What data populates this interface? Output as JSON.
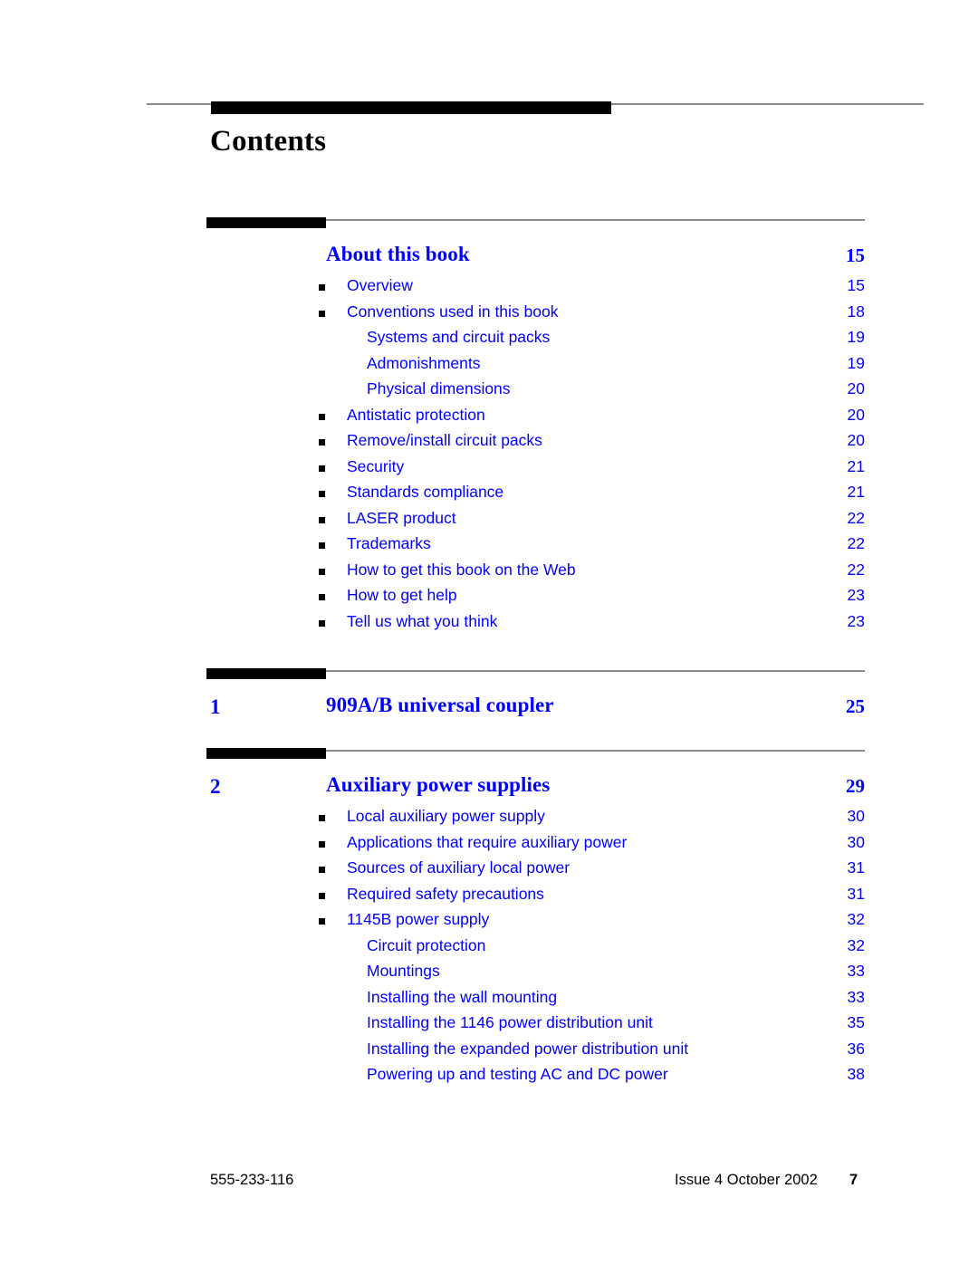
{
  "document": {
    "page_title": "Contents",
    "accent_color": "#0000ff",
    "rule_color": "#8a8a8a",
    "bar_color": "#000000"
  },
  "toc": {
    "sections": [
      {
        "number": "",
        "title": "About this book",
        "page": "15",
        "entries": [
          {
            "level": 1,
            "label": "Overview",
            "page": "15"
          },
          {
            "level": 1,
            "label": "Conventions used in this book",
            "page": "18"
          },
          {
            "level": 2,
            "label": "Systems and circuit packs",
            "page": "19"
          },
          {
            "level": 2,
            "label": "Admonishments",
            "page": "19"
          },
          {
            "level": 2,
            "label": "Physical dimensions",
            "page": "20"
          },
          {
            "level": 1,
            "label": "Antistatic protection",
            "page": "20"
          },
          {
            "level": 1,
            "label": "Remove/install circuit packs",
            "page": "20"
          },
          {
            "level": 1,
            "label": "Security",
            "page": "21"
          },
          {
            "level": 1,
            "label": "Standards compliance",
            "page": "21"
          },
          {
            "level": 1,
            "label": "LASER product",
            "page": "22"
          },
          {
            "level": 1,
            "label": "Trademarks",
            "page": "22"
          },
          {
            "level": 1,
            "label": "How to get this book on the Web",
            "page": "22"
          },
          {
            "level": 1,
            "label": "How to get help",
            "page": "23"
          },
          {
            "level": 1,
            "label": "Tell us what you think",
            "page": "23"
          }
        ]
      },
      {
        "number": "1",
        "title": "909A/B universal coupler",
        "page": "25",
        "entries": []
      },
      {
        "number": "2",
        "title": "Auxiliary power supplies",
        "page": "29",
        "entries": [
          {
            "level": 1,
            "label": "Local auxiliary power supply",
            "page": "30"
          },
          {
            "level": 1,
            "label": "Applications that require auxiliary power",
            "page": "30"
          },
          {
            "level": 1,
            "label": "Sources of auxiliary local power",
            "page": "31"
          },
          {
            "level": 1,
            "label": "Required safety precautions",
            "page": "31"
          },
          {
            "level": 1,
            "label": "1145B power supply",
            "page": "32"
          },
          {
            "level": 2,
            "label": "Circuit protection",
            "page": "32"
          },
          {
            "level": 2,
            "label": "Mountings",
            "page": "33"
          },
          {
            "level": 2,
            "label": "Installing the wall mounting",
            "page": "33"
          },
          {
            "level": 2,
            "label": "Installing the 1146 power distribution unit",
            "page": "35"
          },
          {
            "level": 2,
            "label": "Installing the expanded power distribution unit",
            "page": "36"
          },
          {
            "level": 2,
            "label": "Powering up and testing AC and DC power",
            "page": "38"
          }
        ]
      }
    ]
  },
  "footer": {
    "doc_id": "555-233-116",
    "issue": "Issue 4   October 2002",
    "folio": "7"
  }
}
